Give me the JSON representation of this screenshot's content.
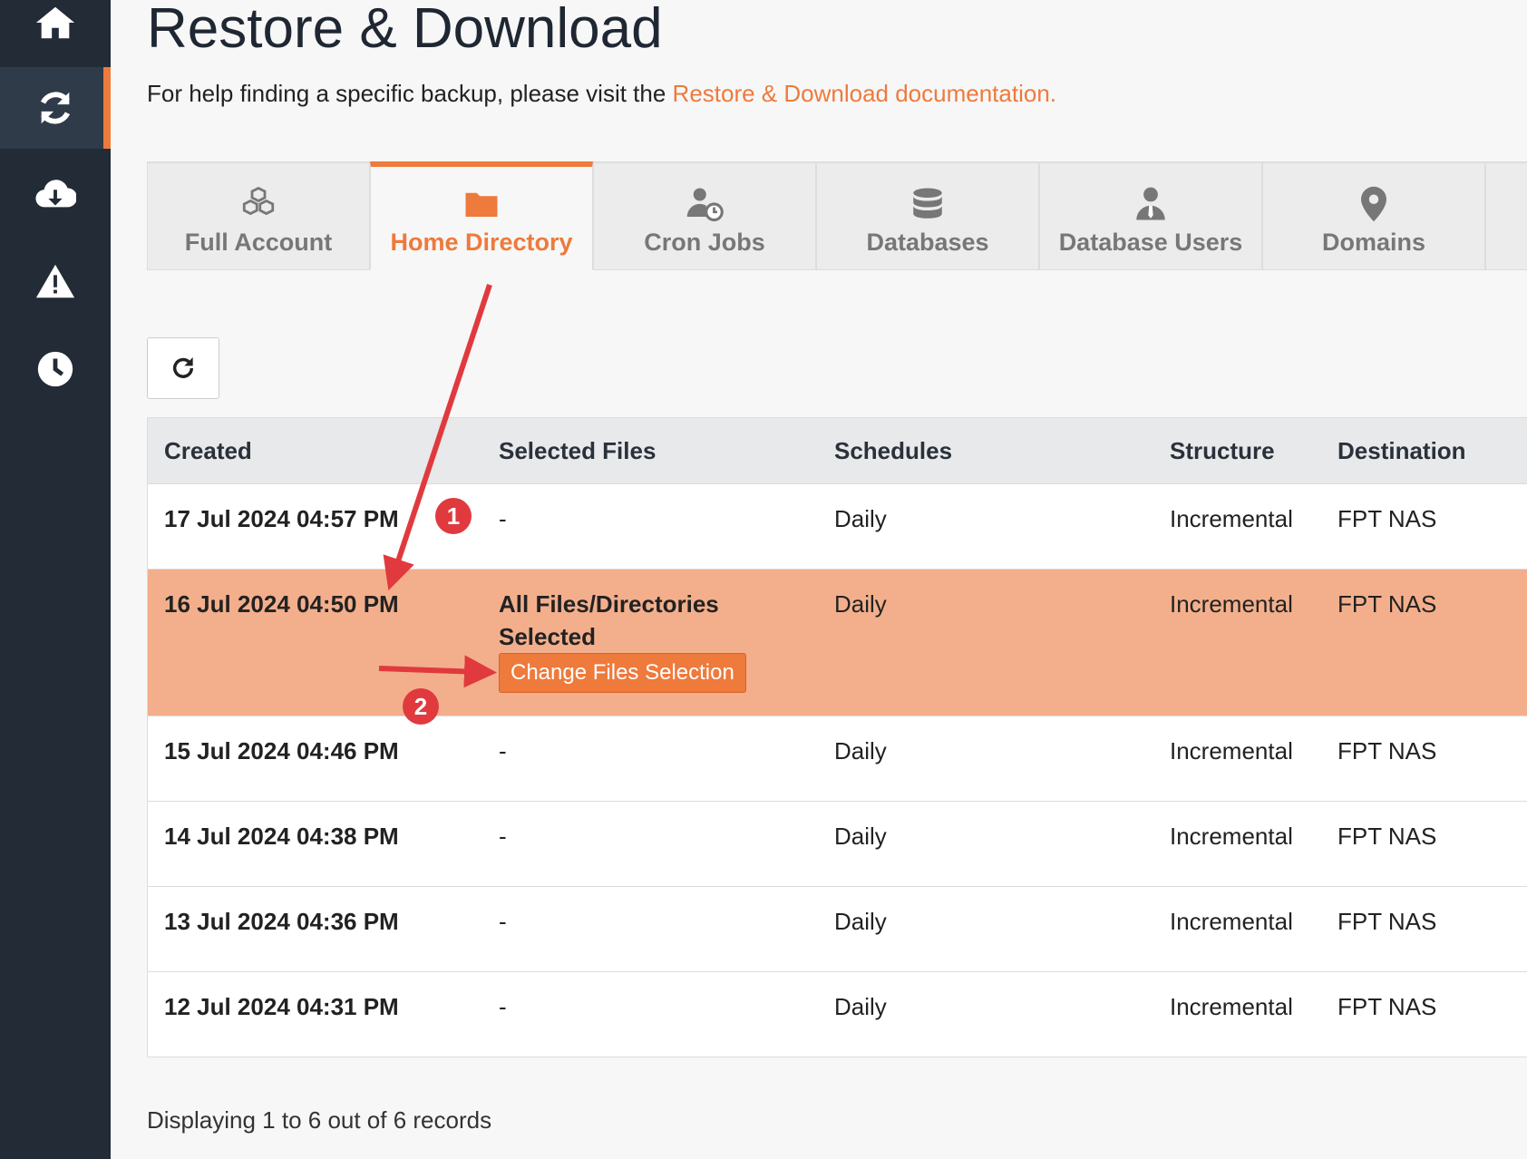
{
  "page": {
    "title": "Restore & Download",
    "help_text": "For help finding a specific backup, please visit the ",
    "help_link": "Restore & Download documentation."
  },
  "sidebar": {
    "items": [
      {
        "icon": "home-icon"
      },
      {
        "icon": "sync-icon",
        "active": true
      },
      {
        "icon": "cloud-download-icon"
      },
      {
        "icon": "warning-icon"
      },
      {
        "icon": "clock-icon"
      }
    ]
  },
  "tabs": [
    {
      "label": "Full Account",
      "icon": "cubes-icon"
    },
    {
      "label": "Home Directory",
      "icon": "folder-icon",
      "active": true
    },
    {
      "label": "Cron Jobs",
      "icon": "user-clock-icon"
    },
    {
      "label": "Databases",
      "icon": "database-icon"
    },
    {
      "label": "Database Users",
      "icon": "user-tie-icon"
    },
    {
      "label": "Domains",
      "icon": "map-pin-icon"
    }
  ],
  "table": {
    "headers": [
      "Created",
      "Selected Files",
      "Schedules",
      "Structure",
      "Destination"
    ],
    "rows": [
      {
        "created": "17 Jul 2024 04:57 PM",
        "files": "-",
        "schedule": "Daily",
        "structure": "Incremental",
        "destination": "FPT NAS"
      },
      {
        "created": "16 Jul 2024 04:50 PM",
        "files": "All Files/Directories Selected",
        "schedule": "Daily",
        "structure": "Incremental",
        "destination": "FPT NAS",
        "selected": true,
        "action": "Change Files Selection"
      },
      {
        "created": "15 Jul 2024 04:46 PM",
        "files": "-",
        "schedule": "Daily",
        "structure": "Incremental",
        "destination": "FPT NAS"
      },
      {
        "created": "14 Jul 2024 04:38 PM",
        "files": "-",
        "schedule": "Daily",
        "structure": "Incremental",
        "destination": "FPT NAS"
      },
      {
        "created": "13 Jul 2024 04:36 PM",
        "files": "-",
        "schedule": "Daily",
        "structure": "Incremental",
        "destination": "FPT NAS"
      },
      {
        "created": "12 Jul 2024 04:31 PM",
        "files": "-",
        "schedule": "Daily",
        "structure": "Incremental",
        "destination": "FPT NAS"
      }
    ]
  },
  "footer": {
    "text": "Displaying 1 to 6 out of 6 records"
  },
  "annotations": {
    "badge_1": "1",
    "badge_2": "2"
  },
  "colors": {
    "accent": "#ee7a3c",
    "sidebar": "#222b36",
    "selected_row": "#f3af8c",
    "annotation": "#e03a3e"
  }
}
